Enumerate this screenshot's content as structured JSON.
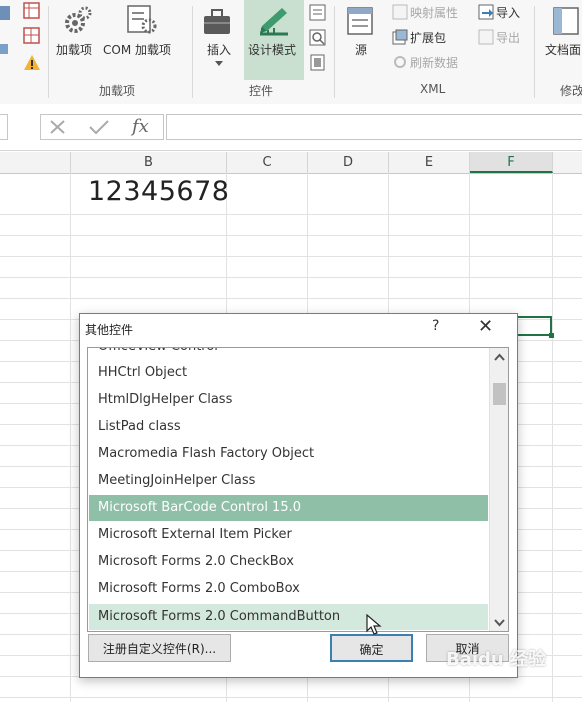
{
  "ribbon": {
    "groups": {
      "addins": "加载项",
      "controls": "控件",
      "xml": "XML",
      "modify": "修改"
    },
    "buttons": {
      "addins": "加载项",
      "com_addins": "COM 加载项",
      "insert": "插入",
      "design_mode": "设计模式",
      "source": "源",
      "map_properties": "映射属性",
      "expansion_packs": "扩展包",
      "refresh_data": "刷新数据",
      "import": "导入",
      "export": "导出",
      "doc_panel": "文档面"
    }
  },
  "formula_bar": {
    "fx": "fx",
    "value": ""
  },
  "sheet": {
    "columns": [
      "B",
      "C",
      "D",
      "E",
      "F"
    ],
    "selected_column": "F",
    "cell_b1": "12345678"
  },
  "dialog": {
    "title": "其他控件",
    "help": "?",
    "close": "✕",
    "items": [
      "OfficeView Control",
      "HHCtrl Object",
      "HtmlDlgHelper Class",
      "ListPad class",
      "Macromedia Flash Factory Object",
      "MeetingJoinHelper Class",
      "Microsoft BarCode Control 15.0",
      "Microsoft External Item Picker",
      "Microsoft Forms 2.0 CheckBox",
      "Microsoft Forms 2.0 ComboBox",
      "Microsoft Forms 2.0 CommandButton"
    ],
    "selected_item": "Microsoft BarCode Control 15.0",
    "register_button": "注册自定义控件(R)...",
    "ok_button": "确定",
    "cancel_button": "取消"
  },
  "watermark": "Baidu 经验",
  "colors": {
    "accent_green": "#217346",
    "selection": "#8fbfa6"
  }
}
